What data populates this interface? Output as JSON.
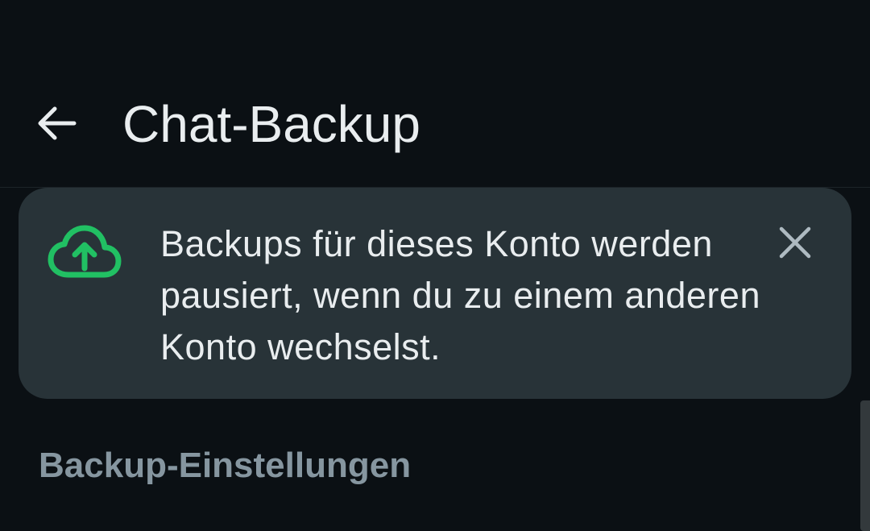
{
  "header": {
    "title": "Chat-Backup",
    "back_icon": "arrow-left-icon"
  },
  "banner": {
    "icon": "cloud-upload-icon",
    "message": "Backups für dieses Konto werden pausiert, wenn du zu einem anderen Konto wechselst.",
    "close_icon": "close-icon"
  },
  "settings": {
    "section_title": "Backup-Einstellungen"
  },
  "colors": {
    "background": "#0b1014",
    "banner_background": "#283338",
    "accent_green": "#21c063",
    "text_primary": "#e9edef",
    "text_secondary": "#8696a0"
  }
}
